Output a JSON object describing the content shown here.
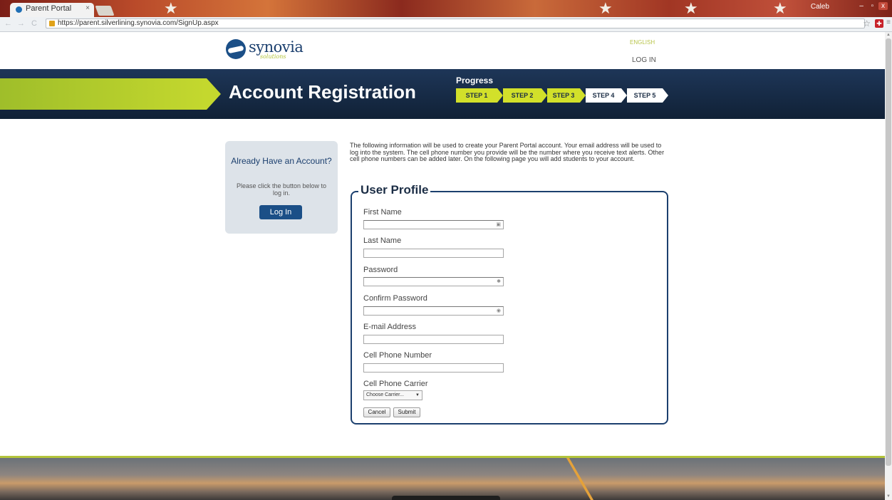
{
  "browser": {
    "tab_title": "Parent Portal",
    "tab_close": "×",
    "url": "https://parent.silverlining.synovia.com/SignUp.aspx",
    "user_name": "Caleb",
    "window_controls": [
      "–",
      "▫",
      "x"
    ],
    "back_icon": "back-arrow-icon",
    "forward_icon": "forward-arrow-icon",
    "reload_icon": "reload-icon"
  },
  "header": {
    "logo_text": "synovia",
    "logo_sub": "solutions",
    "language_link": "ENGLISH",
    "login_link": "LOG IN"
  },
  "banner": {
    "title": "Account Registration",
    "progress_label": "Progress",
    "steps": [
      {
        "label": "STEP 1",
        "state": "done"
      },
      {
        "label": "STEP 2",
        "state": "done"
      },
      {
        "label": "STEP 3",
        "state": "done"
      },
      {
        "label": "STEP 4",
        "state": "todo"
      },
      {
        "label": "STEP 5",
        "state": "todo"
      }
    ]
  },
  "sidebar": {
    "title": "Already Have an Account?",
    "text": "Please click the button below to log in.",
    "button": "Log In"
  },
  "intro": "The following information will be used to create your Parent Portal account. Your email address will be used to log into the system. The cell phone number you provide will be the number where you receive text alerts. Other cell phone numbers can be added later. On the following page you will add students to your account.",
  "form": {
    "legend": "User Profile",
    "fields": {
      "first_name": {
        "label": "First Name",
        "value": ""
      },
      "last_name": {
        "label": "Last Name",
        "value": ""
      },
      "password": {
        "label": "Password",
        "value": ""
      },
      "confirm_password": {
        "label": "Confirm Password",
        "value": ""
      },
      "email": {
        "label": "E-mail Address",
        "value": ""
      },
      "cell_phone": {
        "label": "Cell Phone Number",
        "value": ""
      },
      "carrier": {
        "label": "Cell Phone Carrier",
        "selected": "Choose Carrier..."
      }
    },
    "cancel_button": "Cancel",
    "submit_button": "Submit"
  },
  "colors": {
    "navy": "#1b3f6e",
    "lime": "#c4d82e",
    "banner": "#162a45"
  }
}
